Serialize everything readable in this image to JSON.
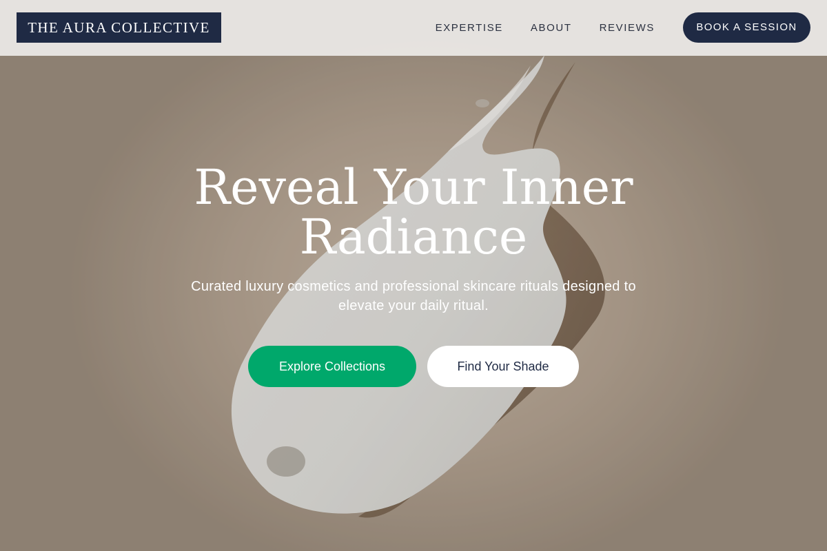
{
  "header": {
    "logo_text": "THE AURA COLLECTIVE",
    "nav": [
      {
        "label": "EXPERTISE"
      },
      {
        "label": "ABOUT"
      },
      {
        "label": "REVIEWS"
      }
    ],
    "cta_label": "BOOK A SESSION"
  },
  "hero": {
    "title_line1": "Reveal Your Inner",
    "title_line2": "Radiance",
    "subtitle": "Curated luxury cosmetics and professional skincare rituals designed to elevate your daily ritual.",
    "primary_button": "Explore Collections",
    "secondary_button": "Find Your Shade",
    "background_image": "cream-smear-texture"
  },
  "colors": {
    "navy": "#1f2a44",
    "green": "#00a86b",
    "white": "#ffffff",
    "header_bg": "#eceae7"
  }
}
